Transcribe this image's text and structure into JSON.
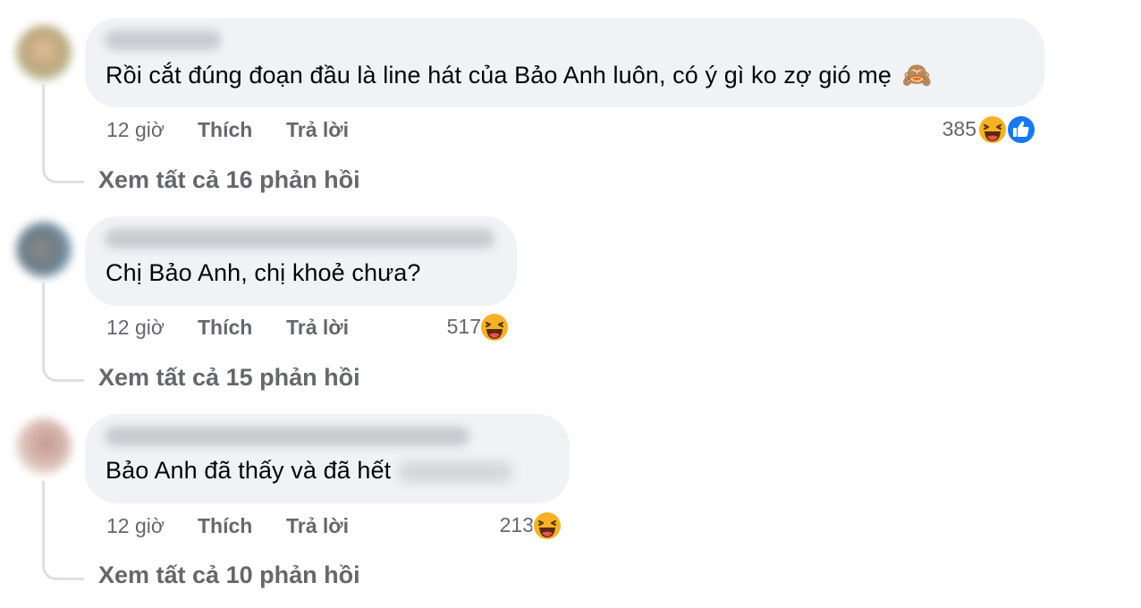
{
  "comments": [
    {
      "text": "Rồi cắt đúng đoạn đầu là line hát của Bảo Anh luôn, có ý gì ko zợ gió mẹ",
      "emoji": "🙈",
      "time": "12 giờ",
      "like_label": "Thích",
      "reply_label": "Trả lời",
      "reaction_count": "385",
      "reactions": [
        "haha-icon",
        "like-icon"
      ],
      "view_replies": "Xem tất cả 16 phản hồi"
    },
    {
      "text": "Chị Bảo Anh, chị khoẻ chưa?",
      "time": "12 giờ",
      "like_label": "Thích",
      "reply_label": "Trả lời",
      "reaction_count": "517",
      "reactions": [
        "haha-icon"
      ],
      "view_replies": "Xem tất cả 15 phản hồi"
    },
    {
      "text": "Bảo Anh đã thấy và đã hết",
      "time": "12 giờ",
      "like_label": "Thích",
      "reply_label": "Trả lời",
      "reaction_count": "213",
      "reactions": [
        "haha-icon"
      ],
      "view_replies": "Xem tất cả 10 phản hồi"
    }
  ],
  "colors": {
    "bubble": "#f0f2f5",
    "meta_text": "#65676b",
    "haha": "#f7b125",
    "like": "#1877f2"
  }
}
